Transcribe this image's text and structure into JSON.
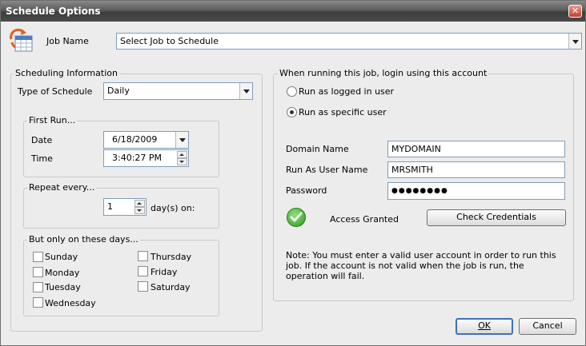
{
  "window": {
    "title": "Schedule Options"
  },
  "job": {
    "label": "Job Name",
    "value": "Select Job to Schedule"
  },
  "scheduling": {
    "title": "Scheduling Information",
    "type_label": "Type of Schedule",
    "type_value": "Daily",
    "first_run": {
      "title": "First Run...",
      "date_label": "Date",
      "date_value": "6/18/2009",
      "time_label": "Time",
      "time_value": "3:40:27 PM"
    },
    "repeat": {
      "title": "Repeat every...",
      "value": "1",
      "suffix": "day(s) on:"
    },
    "days": {
      "title": "But only on these days...",
      "items": [
        "Sunday",
        "Monday",
        "Tuesday",
        "Wednesday",
        "Thursday",
        "Friday",
        "Saturday"
      ]
    }
  },
  "login": {
    "title": "When running this job, login using this account",
    "option_logged_in": "Run as logged in user",
    "option_specific": "Run as specific user",
    "selected": "Run as specific user",
    "domain_label": "Domain Name",
    "domain_value": "MYDOMAIN",
    "user_label": "Run As User Name",
    "user_value": "MRSMITH",
    "password_label": "Password",
    "password_value": "●●●●●●●●",
    "status": "Access Granted",
    "check_button": "Check Credentials",
    "note": "Note: You must enter a valid user account in order to run this job. If the account is not valid when the job is run, the operation will fail."
  },
  "buttons": {
    "ok": "OK",
    "cancel": "Cancel"
  }
}
